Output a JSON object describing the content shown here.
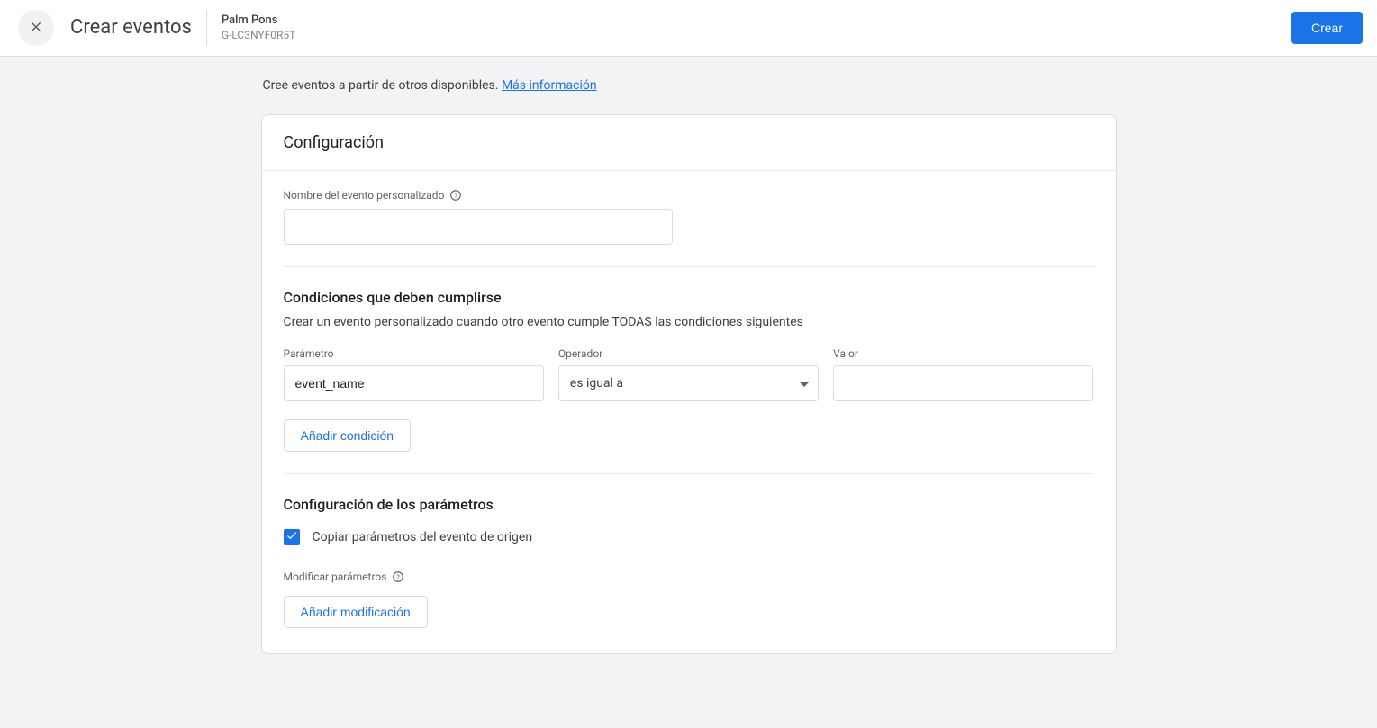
{
  "header": {
    "title": "Crear eventos",
    "property_name": "Palm Pons",
    "property_id": "G-LC3NYF0R5T",
    "create_label": "Crear"
  },
  "intro": {
    "text": "Cree eventos a partir de otros disponibles.",
    "link_label": "Más información"
  },
  "card": {
    "title": "Configuración",
    "event_name_label": "Nombre del evento personalizado",
    "event_name_value": "",
    "conditions": {
      "title": "Condiciones que deben cumplirse",
      "desc": "Crear un evento personalizado cuando otro evento cumple TODAS las condiciones siguientes",
      "col_param": "Parámetro",
      "col_op": "Operador",
      "col_val": "Valor",
      "row": {
        "param": "event_name",
        "op": "es igual a",
        "val": ""
      },
      "add_label": "Añadir condición"
    },
    "params": {
      "title": "Configuración de los parámetros",
      "copy_label": "Copiar parámetros del evento de origen",
      "copy_checked": true,
      "modify_label": "Modificar parámetros",
      "add_mod_label": "Añadir modificación"
    }
  }
}
